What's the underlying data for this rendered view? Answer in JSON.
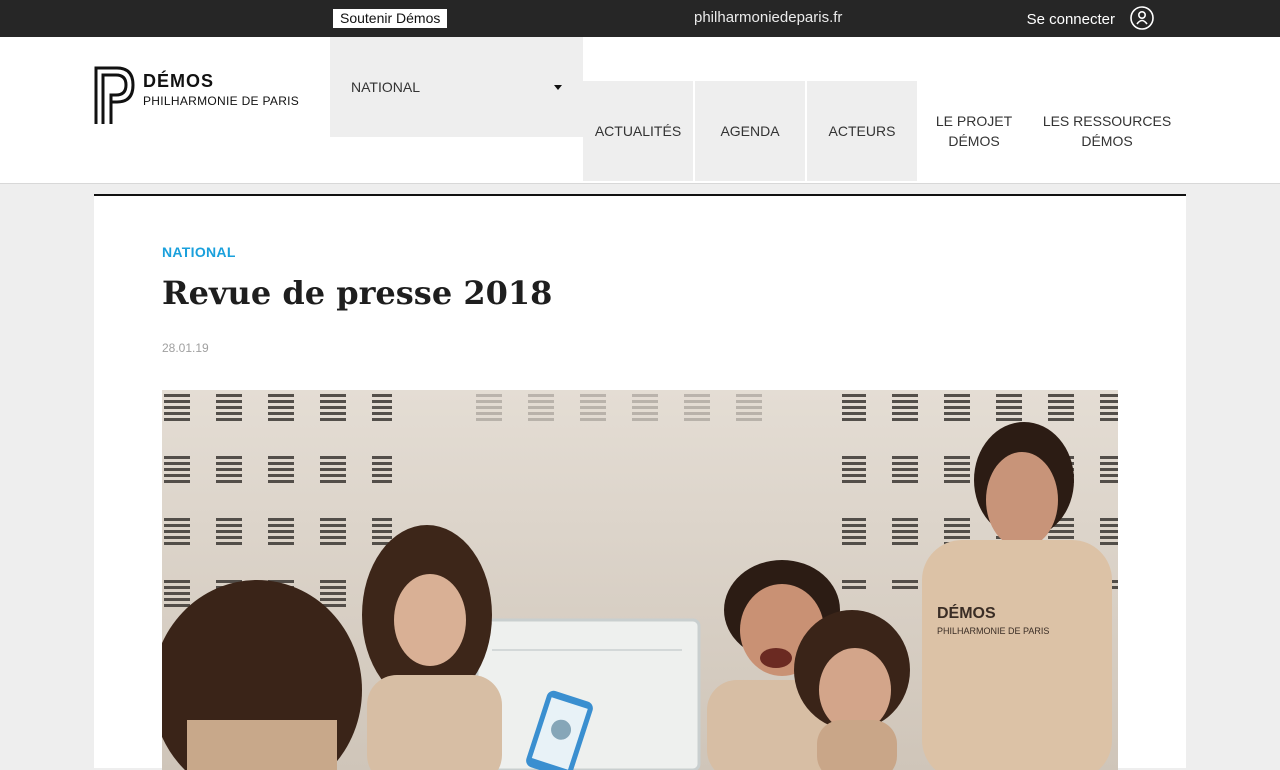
{
  "topbar": {
    "support_label": "Soutenir Démos",
    "site_link": "philharmoniedeparis.fr",
    "login_label": "Se connecter",
    "login_icon": "user-icon"
  },
  "logo": {
    "title": "DÉMOS",
    "subtitle": "PHILHARMONIE DE PARIS"
  },
  "nav": {
    "dropdown_label": "NATIONAL",
    "items": [
      {
        "label": "ACTUALITÉS"
      },
      {
        "label": "AGENDA"
      },
      {
        "label": "ACTEURS"
      },
      {
        "label_line1": "LE PROJET",
        "label_line2": "DÉMOS"
      },
      {
        "label_line1": "LES RESSOURCES",
        "label_line2": "DÉMOS"
      }
    ]
  },
  "article": {
    "category": "NATIONAL",
    "title": "Revue de presse 2018",
    "date": "28.01.19",
    "photo_shirt_title": "DÉMOS",
    "photo_shirt_subtitle": "PHILHARMONIE DE PARIS"
  },
  "colors": {
    "topbar_bg": "#262626",
    "accent_blue": "#1aa0dc",
    "nav_box_bg": "#eeeeee"
  }
}
